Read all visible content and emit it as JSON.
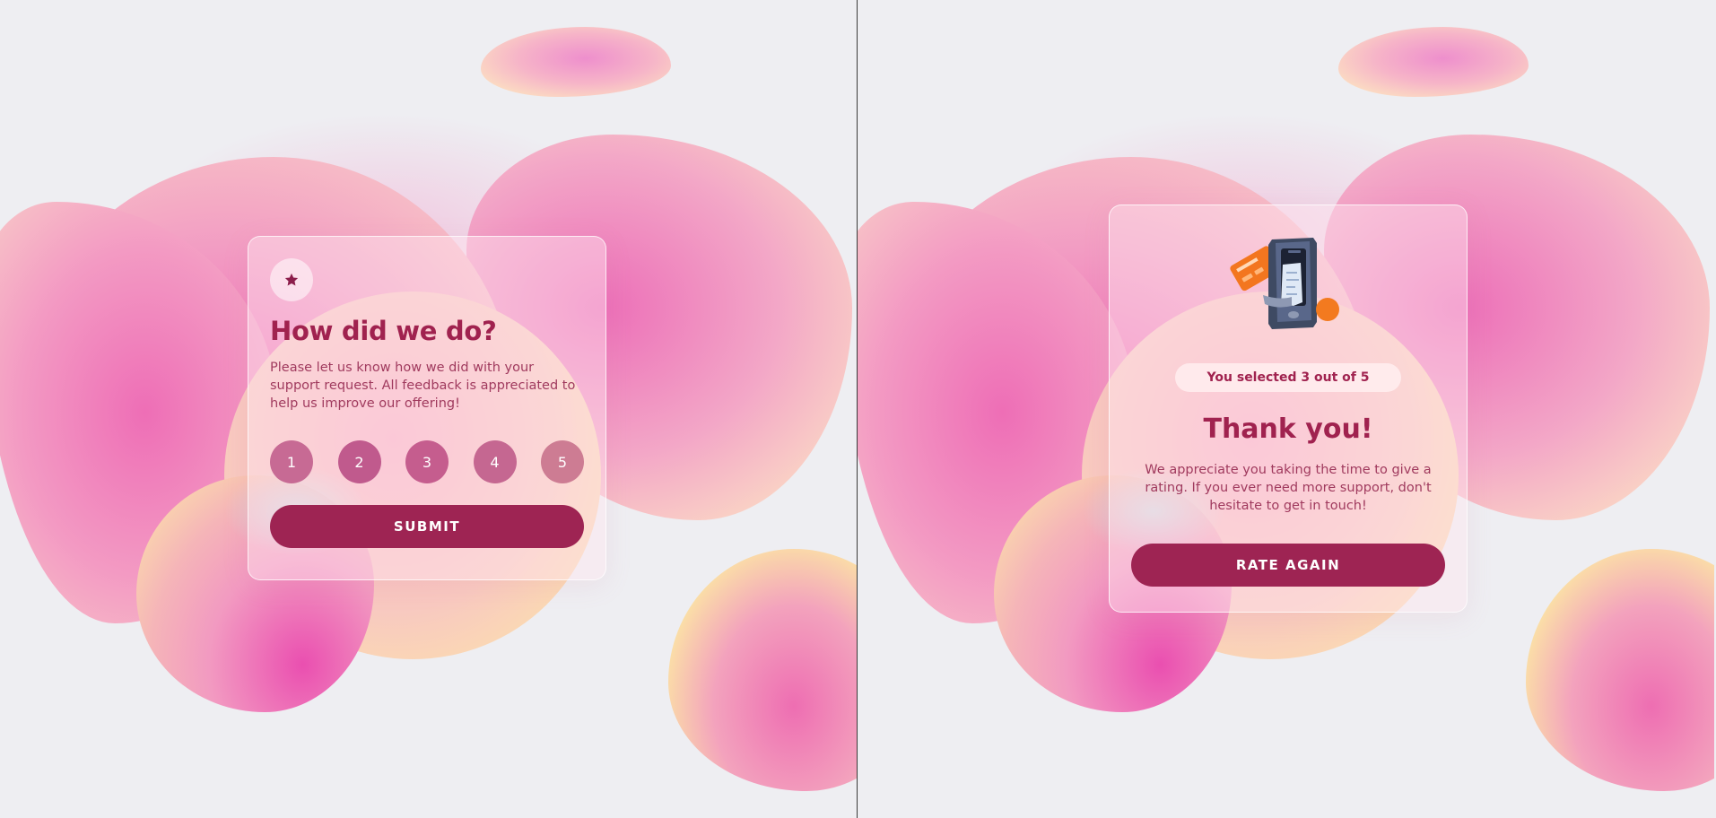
{
  "rating_card": {
    "icon": "star-icon",
    "title": "How did we do?",
    "description": "Please let us know how we did with your support request. All feedback is appreciated to help us improve our offering!",
    "options": [
      "1",
      "2",
      "3",
      "4",
      "5"
    ],
    "submit_label": "SUBMIT"
  },
  "thank_you_card": {
    "illustration": "payment-receipt-illustration",
    "selected_text": "You selected 3 out of 5",
    "title": "Thank you!",
    "description": "We appreciate you taking the time to give a rating. If you ever need more support, don't hesitate to get in touch!",
    "button_label": "RATE AGAIN"
  },
  "colors": {
    "accent": "#9e2453",
    "heading": "#a0224f",
    "background": "#eeeef2"
  }
}
